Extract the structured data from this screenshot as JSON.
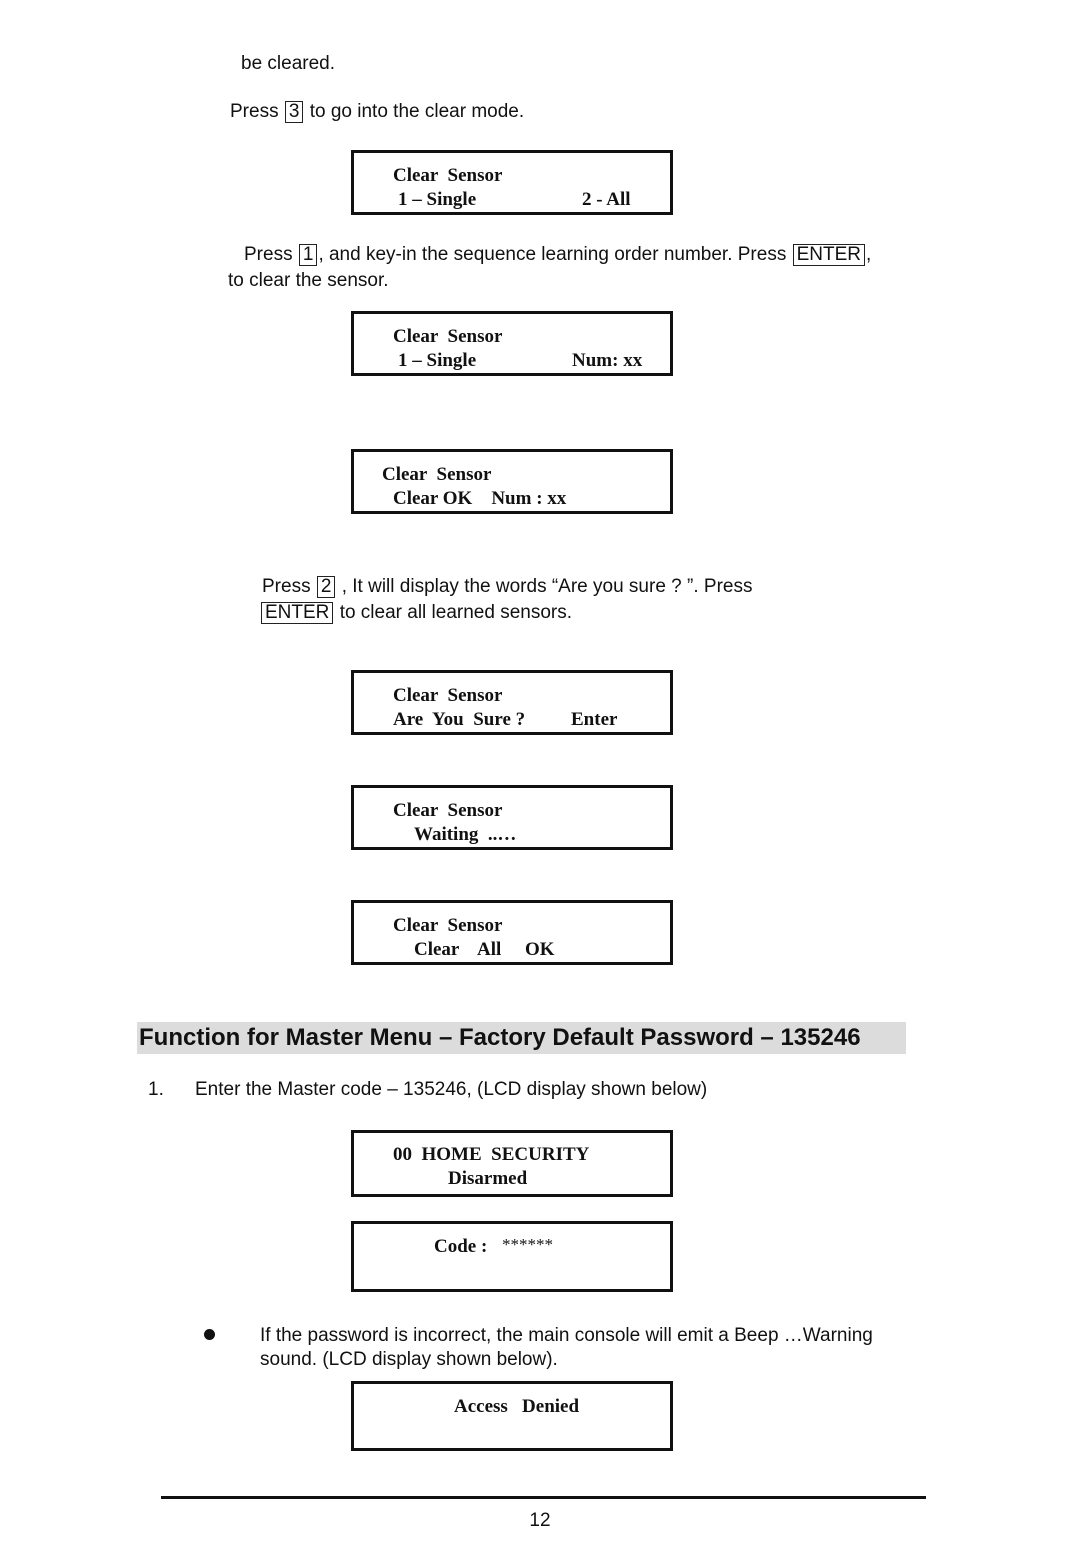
{
  "intro": {
    "continuation": "be cleared.",
    "step_press_3": {
      "prefix": "Press",
      "key": "3",
      "suffix": "to go into the clear mode."
    }
  },
  "lcd_menu": {
    "line1": "Clear  Sensor",
    "line2_left": "1 – Single",
    "line2_right": "2 - All"
  },
  "step_press_1": {
    "prefix": "Press",
    "key": "1",
    "middle": ", and key-in the sequence learning order number. Press",
    "key2": "ENTER",
    "suffix": ",",
    "line2": "to clear the sensor."
  },
  "lcd_single": {
    "line1": "Clear  Sensor",
    "line2_left": "1 – Single",
    "line2_right": "Num: xx"
  },
  "lcd_clear_ok": {
    "line1": "Clear  Sensor",
    "line2": "Clear OK    Num : xx"
  },
  "step_press_2": {
    "prefix": "Press",
    "key": "2",
    "middle": ", It will display the words “Are you sure ? ”. Press",
    "key2": "ENTER",
    "suffix": "to clear all learned sensors."
  },
  "lcd_are_you_sure": {
    "line1": "Clear  Sensor",
    "line2_left": "Are  You  Sure ?",
    "line2_right": "Enter"
  },
  "lcd_waiting": {
    "line1": "Clear  Sensor",
    "line2": "Waiting  ..…"
  },
  "lcd_clear_all_ok": {
    "line1": "Clear  Sensor",
    "line2": "Clear    All     OK"
  },
  "section": {
    "heading": "Function for Master Menu – Factory Default Password – 135246",
    "heading_bg": "#dcdcdc",
    "item1_number": "1.",
    "item1_text": "Enter the Master code – 135246, (LCD display shown below)"
  },
  "lcd_home": {
    "line1": "00  HOME  SECURITY",
    "line2": "Disarmed"
  },
  "lcd_code": {
    "label": "Code :",
    "value": "******"
  },
  "bullet": {
    "icon": "bullet-dot-icon",
    "line1": "If the password is incorrect, the main console will emit a Beep …Warning",
    "line2": "sound. (LCD display shown below)."
  },
  "lcd_access": {
    "line1": "Access   Denied"
  },
  "footer": {
    "page_number": "12"
  }
}
